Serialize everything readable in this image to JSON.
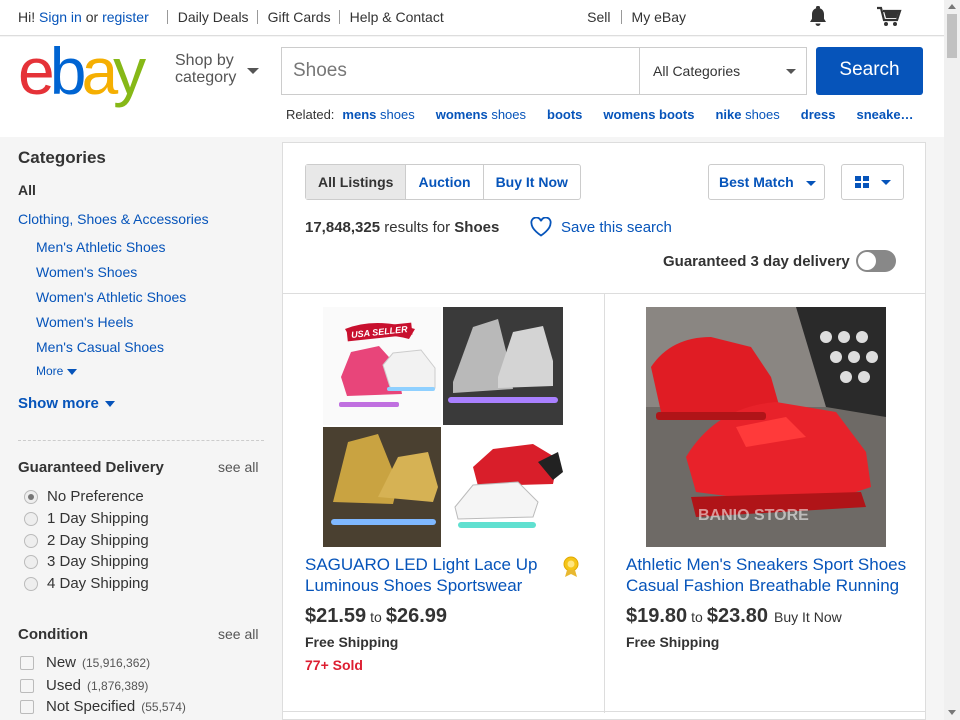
{
  "topbar": {
    "greeting": "Hi!",
    "sign_in": "Sign in",
    "or": "or",
    "register": "register",
    "links": [
      "Daily Deals",
      "Gift Cards",
      "Help & Contact"
    ],
    "sell": "Sell",
    "my_ebay": "My eBay",
    "icons": {
      "bell": "notification-bell-icon",
      "cart": "shopping-cart-icon"
    }
  },
  "header": {
    "logo": {
      "e": "e",
      "b": "b",
      "a": "a",
      "y": "y"
    },
    "shop_by_line1": "Shop by",
    "shop_by_line2": "category",
    "search_value": "Shoes",
    "category_select": "All Categories",
    "search_button": "Search",
    "related_label": "Related:",
    "related": [
      {
        "bold": "mens",
        "rest": " shoes"
      },
      {
        "bold": "womens",
        "rest": " shoes"
      },
      {
        "bold": "boots",
        "rest": ""
      },
      {
        "bold": "womens boots",
        "rest": ""
      },
      {
        "bold": "nike",
        "rest": " shoes"
      },
      {
        "bold": "dress",
        "rest": ""
      },
      {
        "bold": "sneake…",
        "rest": ""
      }
    ]
  },
  "sidebar": {
    "categories_title": "Categories",
    "all": "All",
    "top_category": "Clothing, Shoes & Accessories",
    "subcategories": [
      "Men's Athletic Shoes",
      "Women's Shoes",
      "Women's Athletic Shoes",
      "Women's Heels",
      "Men's Casual Shoes"
    ],
    "more": "More",
    "show_more": "Show more",
    "guaranteed_delivery": {
      "title": "Guaranteed Delivery",
      "see_all": "see all",
      "options": [
        {
          "label": "No Preference",
          "selected": true
        },
        {
          "label": "1 Day Shipping",
          "selected": false
        },
        {
          "label": "2 Day Shipping",
          "selected": false
        },
        {
          "label": "3 Day Shipping",
          "selected": false
        },
        {
          "label": "4 Day Shipping",
          "selected": false
        }
      ]
    },
    "condition": {
      "title": "Condition",
      "see_all": "see all",
      "options": [
        {
          "label": "New",
          "count": "(15,916,362)"
        },
        {
          "label": "Used",
          "count": "(1,876,389)"
        },
        {
          "label": "Not Specified",
          "count": "(55,574)"
        }
      ]
    }
  },
  "main": {
    "tabs": [
      "All Listings",
      "Auction",
      "Buy It Now"
    ],
    "sort": "Best Match",
    "results_count": "17,848,325",
    "results_for": "results for",
    "query": "Shoes",
    "save_search": "Save this search",
    "guaranteed_toggle_label": "Guaranteed 3 day delivery",
    "items": [
      {
        "title_line1": "SAGUARO LED Light Lace Up",
        "title_line2": "Luminous Shoes Sportswear",
        "price_low": "$21.59",
        "to": "to",
        "price_high": "$26.99",
        "format": "",
        "shipping": "Free Shipping",
        "sold": "77+ Sold",
        "badge_text": "USA SELLER"
      },
      {
        "title_line1": "Athletic Men's Sneakers Sport Shoes",
        "title_line2": "Casual Fashion Breathable Running",
        "price_low": "$19.80",
        "to": "to",
        "price_high": "$23.80",
        "format": "Buy It Now",
        "shipping": "Free Shipping",
        "sold": "",
        "watermark": "BANIO STORE"
      }
    ]
  },
  "colors": {
    "link": "#0654ba",
    "search_button": "#0654ba",
    "sold": "#dd1e31"
  }
}
